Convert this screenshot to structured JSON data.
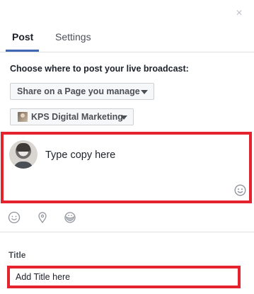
{
  "dialog": {
    "close_glyph": "×"
  },
  "tabs": [
    {
      "label": "Post",
      "active": true
    },
    {
      "label": "Settings",
      "active": false
    }
  ],
  "post": {
    "choose_label": "Choose where to post your live broadcast:",
    "share_dropdown": "Share on a Page you manage",
    "page_dropdown": "KPS Digital Marketing"
  },
  "composer": {
    "placeholder": "Type copy here"
  },
  "icons": [
    "smile-icon",
    "location-pin-icon",
    "sticker-icon",
    "emoji-icon"
  ],
  "title_field": {
    "label": "Title",
    "placeholder": "Add Title here"
  },
  "colors": {
    "highlight": "#e5232e",
    "accent": "#4267b2"
  }
}
